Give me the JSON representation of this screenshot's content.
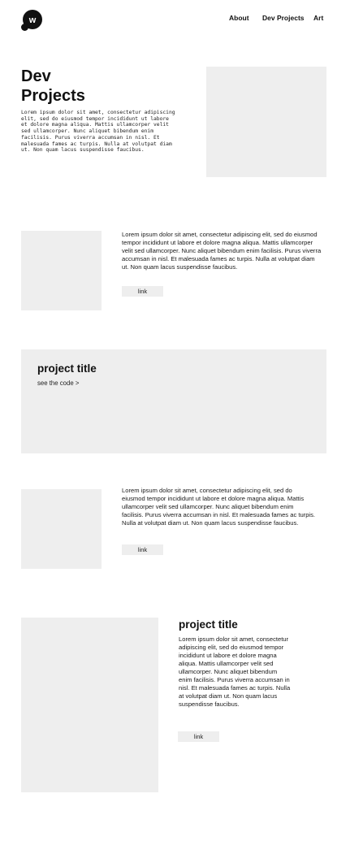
{
  "header": {
    "logo_letter": "w",
    "nav": {
      "about": "About",
      "dev_projects": "Dev Projects",
      "art": "Art"
    }
  },
  "hero": {
    "title_line1": "Dev",
    "title_line2": "Projects",
    "text": "Lorem ipsum dolor sit amet, consectetur adipiscing elit, sed do eiusmod tempor incididunt ut labore et dolore magna aliqua. Mattis ullamcorper velit sed ullamcorper. Nunc aliquet bibendum enim facilisis. Purus viverra accumsan in nisl. Et malesuada fames ac turpis. Nulla at volutpat diam ut. Non quam lacus suspendisse faucibus."
  },
  "section1": {
    "text": "Lorem ipsum dolor sit amet, consectetur adipiscing elit, sed do eiusmod tempor incididunt ut labore et dolore magna aliqua. Mattis ullamcorper velit sed ullamcorper. Nunc aliquet bibendum enim facilisis. Purus viverra accumsan in nisl. Et malesuada fames ac turpis. Nulla at volutpat diam ut. Non quam lacus suspendisse faucibus.",
    "link_label": "link"
  },
  "banner": {
    "title": "project title",
    "code_link": "see the code >"
  },
  "section2": {
    "text": "Lorem ipsum dolor sit amet, consectetur adipiscing elit, sed do eiusmod tempor incididunt ut labore et dolore magna aliqua. Mattis ullamcorper velit sed ullamcorper. Nunc aliquet bibendum enim facilisis. Purus viverra accumsan in nisl. Et malesuada fames ac turpis. Nulla at volutpat diam ut. Non quam lacus suspendisse faucibus.",
    "link_label": "link"
  },
  "section3": {
    "title": "project title",
    "text": "Lorem ipsum dolor sit amet, consectetur adipiscing elit, sed do eiusmod tempor incididunt ut labore et dolore magna aliqua. Mattis ullamcorper velit sed ullamcorper. Nunc aliquet bibendum enim facilisis. Purus viverra accumsan in nisl. Et malesuada fames ac turpis. Nulla at volutpat diam ut. Non quam lacus suspendisse faucibus.",
    "link_label": "link"
  },
  "colors": {
    "placeholder_gray": "#eeeeee",
    "text": "#111111",
    "logo": "#111111"
  },
  "icons": {
    "logo": "logo-icon"
  }
}
